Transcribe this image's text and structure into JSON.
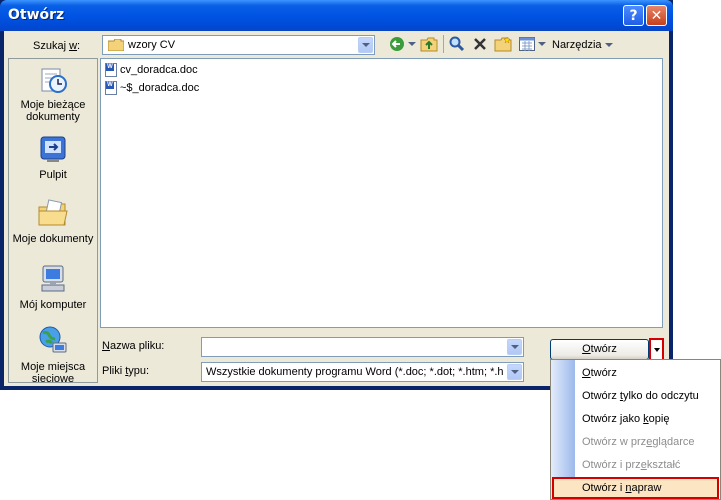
{
  "window": {
    "title": "Otwórz",
    "help_label": "?",
    "close_label": "✕"
  },
  "lookin": {
    "label_pre": "Szukaj ",
    "label_key": "w",
    "label_post": ":",
    "value": "wzory CV"
  },
  "toolbar": {
    "tools_label": "Narzędzia"
  },
  "places": [
    {
      "label": "Moje bieżące dokumenty",
      "icon": "recent-documents-icon"
    },
    {
      "label": "Pulpit",
      "icon": "desktop-icon"
    },
    {
      "label": "Moje dokumenty",
      "icon": "my-documents-icon"
    },
    {
      "label": "Mój komputer",
      "icon": "my-computer-icon"
    },
    {
      "label": "Moje miejsca sieciowe",
      "icon": "network-places-icon"
    }
  ],
  "files": [
    {
      "name": "cv_doradca.doc"
    },
    {
      "name": "~$_doradca.doc"
    }
  ],
  "filename": {
    "label_key": "N",
    "label_rest": "azwa pliku:",
    "value": ""
  },
  "filetype": {
    "label_pre": "Pliki ",
    "label_key": "t",
    "label_rest": "ypu:",
    "value": "Wszystkie dokumenty programu Word (*.doc; *.dot; *.htm; *.h"
  },
  "open_button": {
    "key": "O",
    "rest": "twórz"
  },
  "open_menu": [
    {
      "pre": "",
      "key": "O",
      "post": "twórz",
      "enabled": true
    },
    {
      "pre": "Otwórz ",
      "key": "t",
      "post": "ylko do odczytu",
      "enabled": true
    },
    {
      "pre": "Otwórz jako ",
      "key": "k",
      "post": "opię",
      "enabled": true
    },
    {
      "pre": "Otwórz w prz",
      "key": "e",
      "post": "glądarce",
      "enabled": false
    },
    {
      "pre": "Otwórz i prz",
      "key": "e",
      "post": "kształć",
      "enabled": false
    },
    {
      "pre": "Otwórz i ",
      "key": "n",
      "post": "apraw",
      "enabled": true
    }
  ],
  "colors": {
    "titlebar": "#0054e3",
    "dialog_bg": "#ece9d8",
    "highlight_box": "#d40000",
    "selected_item_bg": "#fbe5c3"
  }
}
